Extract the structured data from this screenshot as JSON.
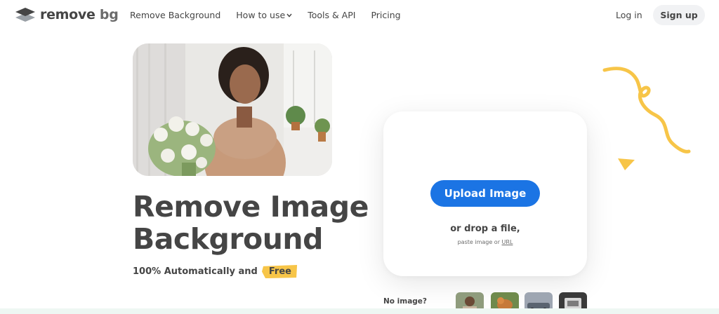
{
  "header": {
    "logo": {
      "text_main": "remove",
      "text_accent": "bg",
      "icon": "layers-logo-icon"
    },
    "nav": [
      {
        "label": "Remove Background"
      },
      {
        "label": "How to use",
        "has_dropdown": true,
        "icon": "chevron-down-icon"
      },
      {
        "label": "Tools & API"
      },
      {
        "label": "Pricing"
      }
    ],
    "login_label": "Log in",
    "signup_label": "Sign up"
  },
  "hero": {
    "photo": "woman-holding-white-flower-bouquet",
    "headline_line1": "Remove Image",
    "headline_line2": "Background",
    "sub_text": "100% Automatically and",
    "free_badge": "Free"
  },
  "upload": {
    "button_label": "Upload Image",
    "drop_text": "or drop a file,",
    "paste_prefix": "paste image or ",
    "paste_link": "URL"
  },
  "samples": {
    "label": "No image?",
    "thumbnails": [
      "person-sample",
      "animal-sample",
      "car-sample",
      "product-sample"
    ]
  },
  "colors": {
    "text": "#454545",
    "primary_blue": "#1b74e4",
    "accent_yellow": "#f7c548",
    "button_grey": "#f1f2f4"
  }
}
